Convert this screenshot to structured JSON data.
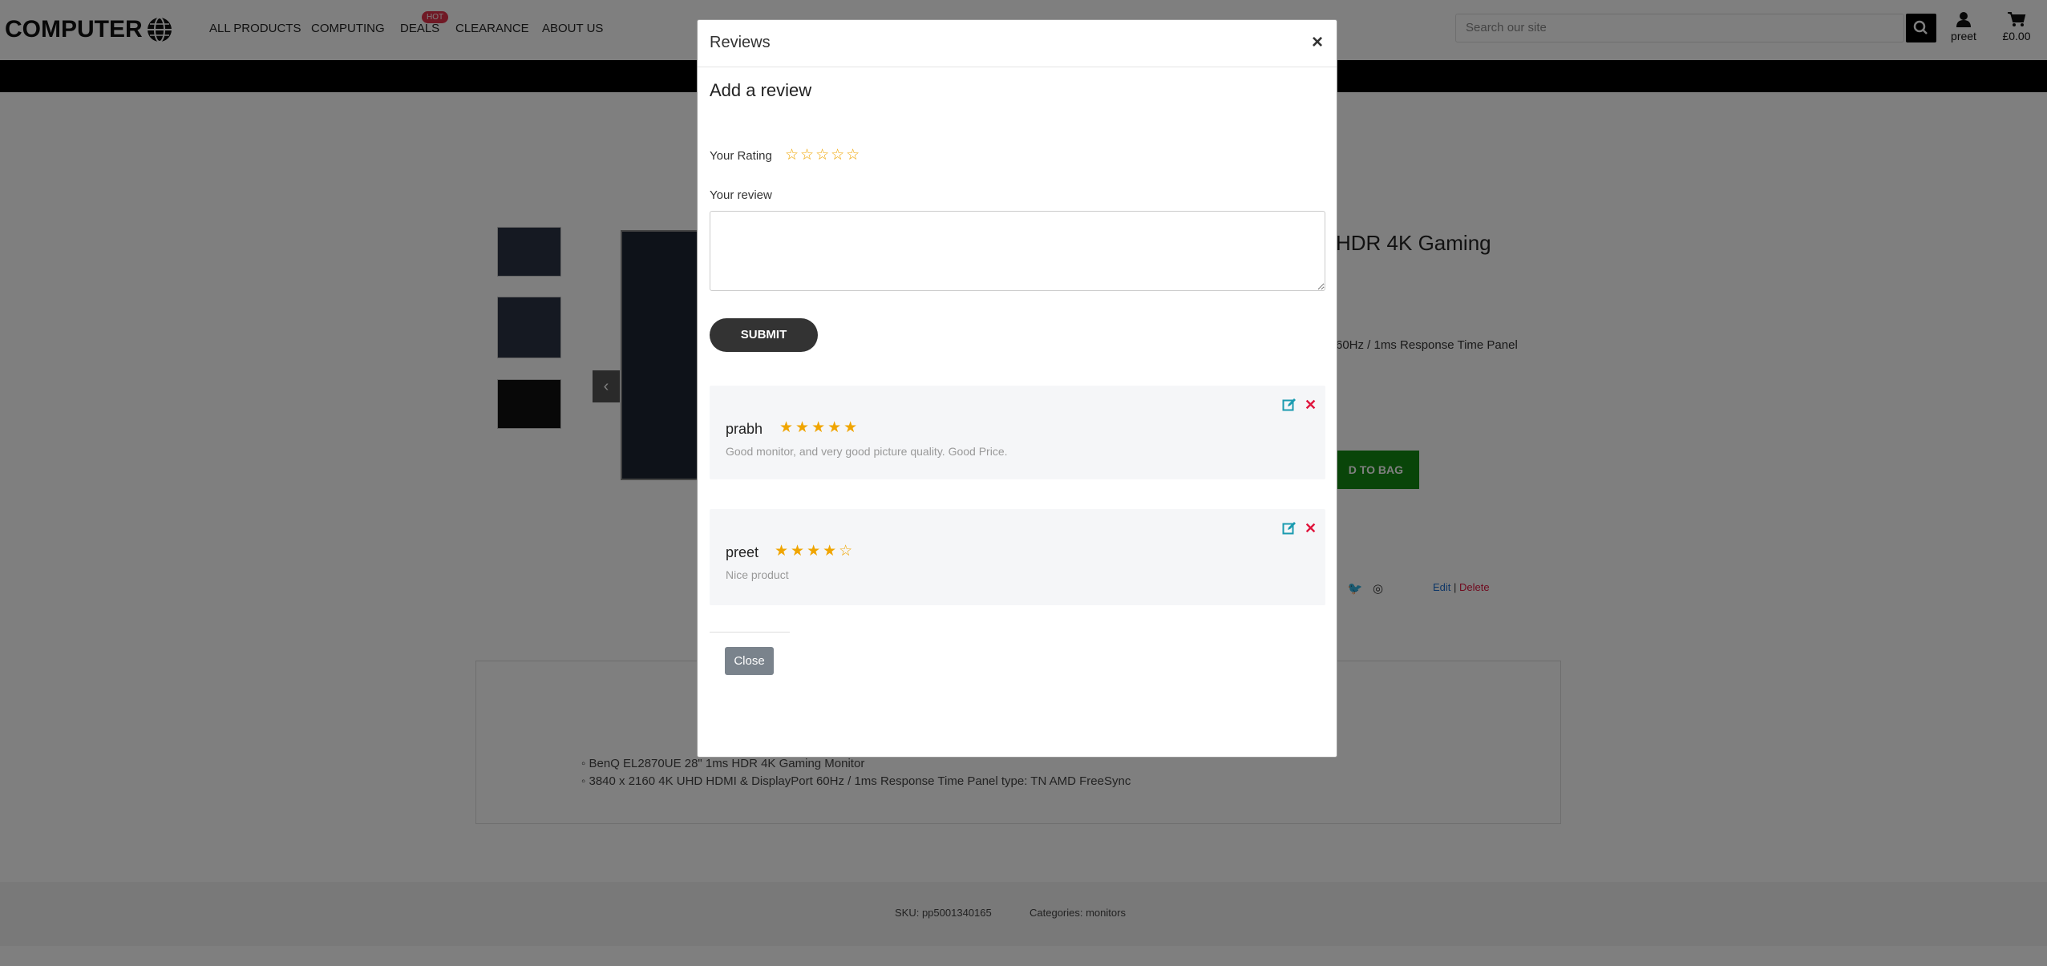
{
  "header": {
    "logo_text": "COMPUTER",
    "nav": [
      "ALL PRODUCTS",
      "COMPUTING",
      "DEALS",
      "CLEARANCE",
      "ABOUT US"
    ],
    "hot_badge": "HOT",
    "search_placeholder": "Search our site",
    "account_label": "preet",
    "cart_label": "£0.00"
  },
  "product": {
    "title_partial": "HDR 4K Gaming",
    "desc_partial": "60Hz / 1ms Response Time Panel",
    "bag_button": "D TO BAG",
    "edit": "Edit",
    "separator": "|",
    "delete": "Delete",
    "bullets": [
      "BenQ EL2870UE 28\" 1ms HDR 4K Gaming Monitor",
      "3840 x 2160 4K UHD HDMI & DisplayPort 60Hz / 1ms Response Time Panel type: TN AMD FreeSync"
    ],
    "sku": "SKU: pp5001340165",
    "categories": "Categories: monitors"
  },
  "modal": {
    "title": "Reviews",
    "close_symbol": "×",
    "add_review_heading": "Add a review",
    "rating_label": "Your Rating",
    "rating_stars": "☆☆☆☆☆",
    "review_label": "Your review",
    "review_value": "",
    "submit_label": "SUBMIT",
    "reviews": [
      {
        "name": "prabh",
        "rating": 5,
        "stars": "★★★★★",
        "text": "Good monitor, and very good picture quality. Good Price."
      },
      {
        "name": "preet",
        "rating": 4,
        "stars": "★★★★☆",
        "text": "Nice product"
      }
    ],
    "delete_symbol": "✕",
    "close_button": "Close"
  },
  "colors": {
    "star": "#f0a500",
    "delete_red": "#e0143c",
    "edit_teal": "#1a9bb0",
    "bag_green": "#128a12"
  }
}
